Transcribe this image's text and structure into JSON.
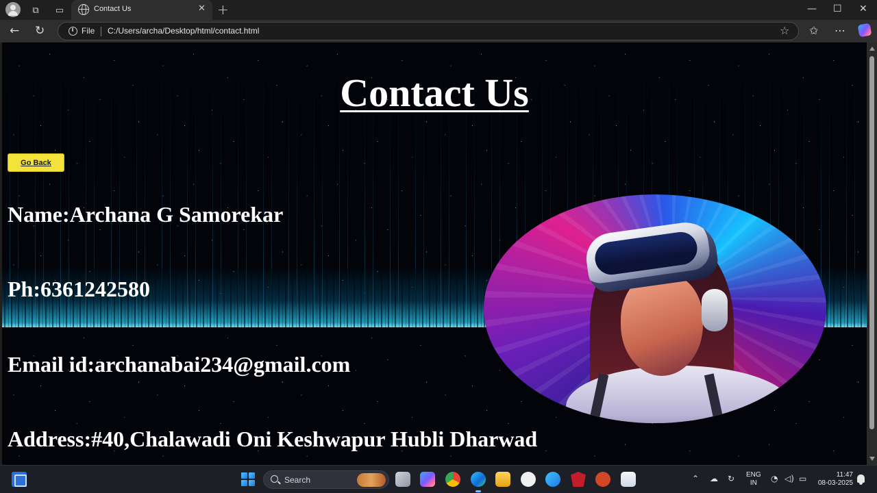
{
  "browser": {
    "tab_title": "Contact Us",
    "tab_close": "✕",
    "new_tab": "+",
    "file_label": "File",
    "url": "C:/Users/archa/Desktop/html/contact.html"
  },
  "page": {
    "title": "Contact Us",
    "go_back_label": "Go Back",
    "name_line": "Name:Archana G Samorekar",
    "phone_line": "Ph:6361242580",
    "email_line": "Email id:archanabai234@gmail.com",
    "address_line": "Address:#40,Chalawadi Oni Keshwapur Hubli Dharwad",
    "background_colors": {
      "base": "#02040a",
      "glow": "#28c8f0"
    },
    "button_color": "#f2e23a"
  },
  "taskbar": {
    "search_label": "Search",
    "lang_top": "ENG",
    "lang_bottom": "IN",
    "time": "11:47",
    "date": "08-03-2025"
  }
}
